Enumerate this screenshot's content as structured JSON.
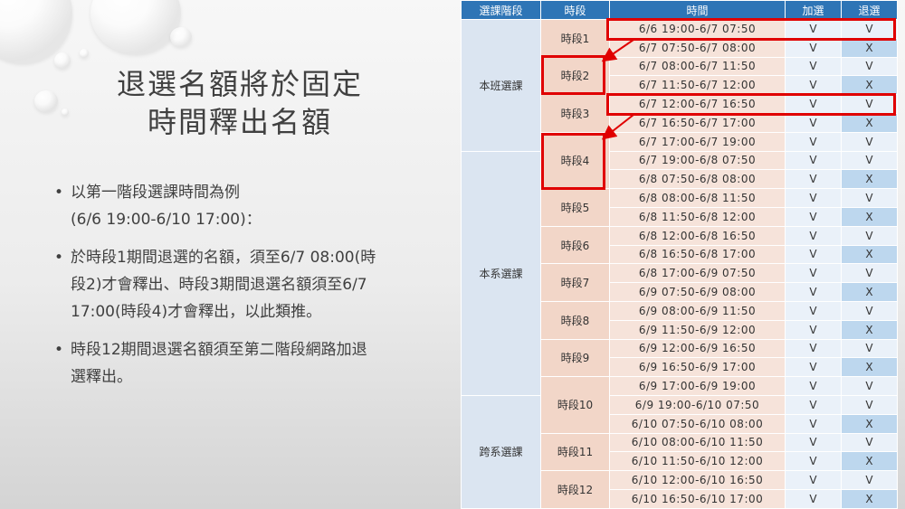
{
  "title_lines": [
    "退選名額將於固定",
    "時間釋出名額"
  ],
  "bullets": [
    {
      "lines": [
        "以第一階段選課時間為例",
        "(6/6 19:00-6/10 17:00)："
      ]
    },
    {
      "lines": [
        "於時段1期間退選的名額，須至6/7 08:00(時",
        "段2)才會釋出、時段3期間退選名額須至6/7",
        "17:00(時段4)才會釋出，以此類推。"
      ]
    },
    {
      "lines": [
        "時段12期間退選名額須至第二階段網路加退",
        "選釋出。"
      ]
    }
  ],
  "table": {
    "headers": [
      "選課階段",
      "時段",
      "時間",
      "加選",
      "退選"
    ],
    "stages": [
      {
        "label": "本班選課",
        "rows": 7
      },
      {
        "label": "本系選課",
        "rows": 13
      },
      {
        "label": "跨系選課",
        "rows": 7
      }
    ],
    "segments": [
      {
        "label": "時段1",
        "rows": 2
      },
      {
        "label": "時段2",
        "rows": 2
      },
      {
        "label": "時段3",
        "rows": 2
      },
      {
        "label": "時段4",
        "rows": 3
      },
      {
        "label": "時段5",
        "rows": 2
      },
      {
        "label": "時段6",
        "rows": 2
      },
      {
        "label": "時段7",
        "rows": 2
      },
      {
        "label": "時段8",
        "rows": 2
      },
      {
        "label": "時段9",
        "rows": 2
      },
      {
        "label": "時段10",
        "rows": 3
      },
      {
        "label": "時段11",
        "rows": 2
      },
      {
        "label": "時段12",
        "rows": 2
      }
    ],
    "rows": [
      {
        "time": "6/6 19:00-6/7 07:50",
        "add": "V",
        "drop": "V"
      },
      {
        "time": "6/7 07:50-6/7 08:00",
        "add": "V",
        "drop": "X"
      },
      {
        "time": "6/7 08:00-6/7 11:50",
        "add": "V",
        "drop": "V"
      },
      {
        "time": "6/7 11:50-6/7 12:00",
        "add": "V",
        "drop": "X"
      },
      {
        "time": "6/7 12:00-6/7 16:50",
        "add": "V",
        "drop": "V"
      },
      {
        "time": "6/7 16:50-6/7 17:00",
        "add": "V",
        "drop": "X"
      },
      {
        "time": "6/7 17:00-6/7 19:00",
        "add": "V",
        "drop": "V"
      },
      {
        "time": "6/7 19:00-6/8 07:50",
        "add": "V",
        "drop": "V"
      },
      {
        "time": "6/8 07:50-6/8 08:00",
        "add": "V",
        "drop": "X"
      },
      {
        "time": "6/8 08:00-6/8 11:50",
        "add": "V",
        "drop": "V"
      },
      {
        "time": "6/8 11:50-6/8 12:00",
        "add": "V",
        "drop": "X"
      },
      {
        "time": "6/8 12:00-6/8 16:50",
        "add": "V",
        "drop": "V"
      },
      {
        "time": "6/8 16:50-6/8 17:00",
        "add": "V",
        "drop": "X"
      },
      {
        "time": "6/8 17:00-6/9 07:50",
        "add": "V",
        "drop": "V"
      },
      {
        "time": "6/9 07:50-6/9 08:00",
        "add": "V",
        "drop": "X"
      },
      {
        "time": "6/9 08:00-6/9 11:50",
        "add": "V",
        "drop": "V"
      },
      {
        "time": "6/9 11:50-6/9 12:00",
        "add": "V",
        "drop": "X"
      },
      {
        "time": "6/9 12:00-6/9 16:50",
        "add": "V",
        "drop": "V"
      },
      {
        "time": "6/9 16:50-6/9 17:00",
        "add": "V",
        "drop": "X"
      },
      {
        "time": "6/9 17:00-6/9 19:00",
        "add": "V",
        "drop": "V"
      },
      {
        "time": "6/9 19:00-6/10 07:50",
        "add": "V",
        "drop": "V"
      },
      {
        "time": "6/10 07:50-6/10 08:00",
        "add": "V",
        "drop": "X"
      },
      {
        "time": "6/10 08:00-6/10 11:50",
        "add": "V",
        "drop": "V"
      },
      {
        "time": "6/10 11:50-6/10 12:00",
        "add": "V",
        "drop": "X"
      },
      {
        "time": "6/10 12:00-6/10 16:50",
        "add": "V",
        "drop": "V"
      },
      {
        "time": "6/10 16:50-6/10 17:00",
        "add": "V",
        "drop": "X"
      }
    ]
  },
  "colors": {
    "header_bg": "#2e75b6",
    "highlight": "#e00000",
    "segment_bg": "#f2d6c8",
    "x_bg": "#bdd7ee"
  }
}
